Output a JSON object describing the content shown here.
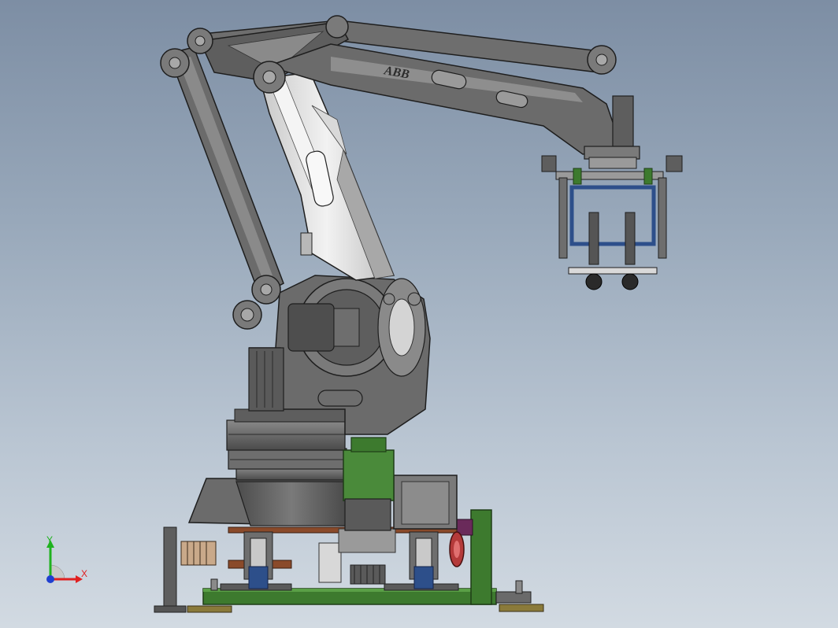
{
  "model": {
    "brand_label": "ABB"
  },
  "triad": {
    "y_label": "Y",
    "x_label": "X",
    "y_color": "#1fb21f",
    "x_color": "#e02020",
    "z_color": "#1f3fd0"
  },
  "colors": {
    "robot_body": "#6b6b6b",
    "robot_light": "#dedede",
    "base_green": "#3d7a2e",
    "gripper_blue": "#2d4f8a",
    "motor_green": "#4a8a3a"
  }
}
